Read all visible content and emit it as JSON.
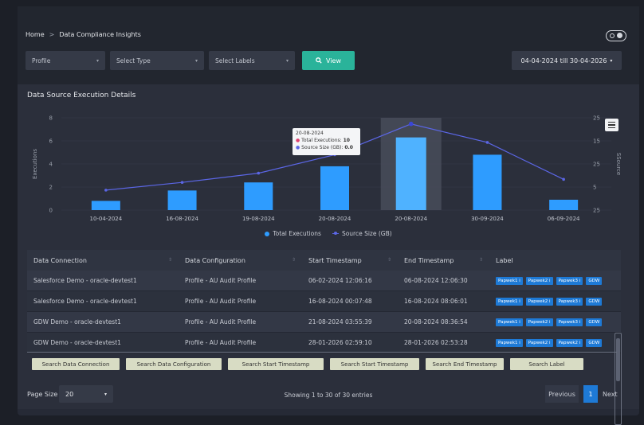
{
  "breadcrumb": {
    "home": "Home",
    "sep": ">",
    "current": "Data Compliance Insights"
  },
  "filters": {
    "profile": "Profile",
    "type": "Select Type",
    "labels": "Select Labels",
    "view_label": "View",
    "date_range": "04-04-2024 till 30-04-2026"
  },
  "card_title": "Data Source Execution Details",
  "tooltip": {
    "date": "20-08-2024",
    "exec_label": "Total Executions:",
    "exec_value": "10",
    "size_label": "Source Size (GB):",
    "size_value": "0.0"
  },
  "chart_data": {
    "type": "bar",
    "categories": [
      "10-04-2024",
      "16-08-2024",
      "19-08-2024",
      "20-08-2024",
      "20-08-2024",
      "30-09-2024",
      "06-09-2024"
    ],
    "series": [
      {
        "name": "Total Executions",
        "type": "bar",
        "values": [
          0.8,
          1.7,
          2.4,
          3.8,
          6.3,
          4.8,
          0.9
        ]
      },
      {
        "name": "Source Size (GB)",
        "type": "line",
        "values": [
          6.5,
          9.0,
          12.0,
          18.0,
          28.0,
          22.0,
          10.0
        ]
      }
    ],
    "ylabel": "Executions",
    "y2label": "SSource",
    "yticks": [
      "0",
      "2",
      "4",
      "6",
      "8"
    ],
    "y2ticks": [
      "25",
      "5",
      "25",
      "15",
      "25"
    ],
    "ylim": [
      0,
      8
    ],
    "legend_position": "bottom"
  },
  "table": {
    "headers": [
      "Data Connection",
      "Data Configuration",
      "Start Timestamp",
      "End Timestamp",
      "Label"
    ],
    "rows": [
      {
        "conn": "Salesforce Demo - oracle-devtest1",
        "config": "Profile - AU Audit Profile",
        "start": "06-02-2024 12:06:16",
        "end": "06-08-2024 12:06:30",
        "tags": [
          "Papwek1 i",
          "Papwek2 i",
          "Papwek3 i",
          "GDW"
        ]
      },
      {
        "conn": "Salesforce Demo - oracle-devtest1",
        "config": "Profile - AU Audit Profile",
        "start": "16-08-2024 00:07:48",
        "end": "16-08-2024 08:06:01",
        "tags": [
          "Papwek1 i",
          "Papwek2 i",
          "Papwek3 i",
          "GDW"
        ]
      },
      {
        "conn": "GDW Demo - oracle-devtest1",
        "config": "Profile - AU Audit Profile",
        "start": "21-08-2024 03:55:39",
        "end": "20-08-2024 08:36:54",
        "tags": [
          "Papwek1 i",
          "Papwek2 i",
          "Papwek3 i",
          "GDW"
        ]
      },
      {
        "conn": "GDW Demo - oracle-devtest1",
        "config": "Profile - AU Audit Profile",
        "start": "28-01-2026 02:59:10",
        "end": "28-01-2026 02:53:28",
        "tags": [
          "Papwek1 i",
          "Papwek2 i",
          "Papwek2 i",
          "GDW"
        ]
      }
    ]
  },
  "search_buttons": [
    "Search Data Connection",
    "Search Data Configuration",
    "Search Start Timestamp",
    "Search Start Timestamp",
    "Search End Timestamp",
    "Search Label"
  ],
  "footer": {
    "page_size_label": "Page Size",
    "page_size_value": "20",
    "showing": "Showing 1 to 30 of 30 entries",
    "prev": "Previous",
    "page": "1",
    "next": "Next"
  },
  "colors": {
    "bar": "#2e9cff",
    "line": "#5b66e5",
    "accent": "#2ab39a",
    "tag": "#1e7ad6"
  }
}
